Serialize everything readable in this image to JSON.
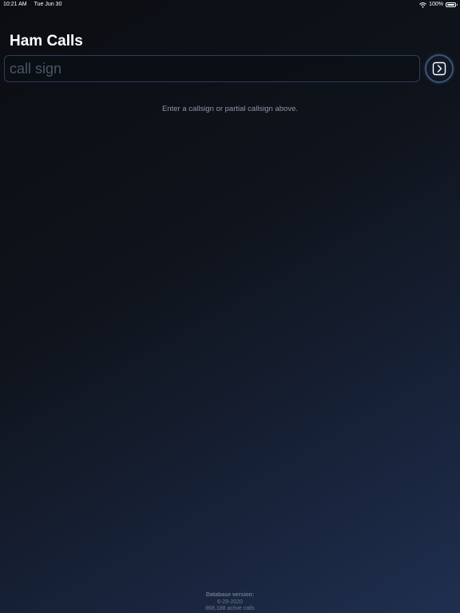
{
  "status_bar": {
    "time": "10:21 AM",
    "date": "Tue Jun 30",
    "battery_percent": "100%",
    "battery_level": 1.0,
    "icons": [
      "wifi-icon",
      "battery-icon"
    ]
  },
  "header": {
    "title": "Ham Calls"
  },
  "search": {
    "value": "",
    "placeholder": "call sign",
    "button_icon": "chevron-right-icon"
  },
  "main": {
    "hint": "Enter a callsign or partial callsign above."
  },
  "footer": {
    "db_label": "Database version:",
    "db_version": "6-29-2020",
    "active_calls": "868,188 active calls"
  },
  "colors": {
    "background_top": "#0b0d12",
    "background_bottom": "#1f2f4f",
    "accent": "#3b5577",
    "text": "#ffffff",
    "muted_text": "#8d96a6"
  }
}
